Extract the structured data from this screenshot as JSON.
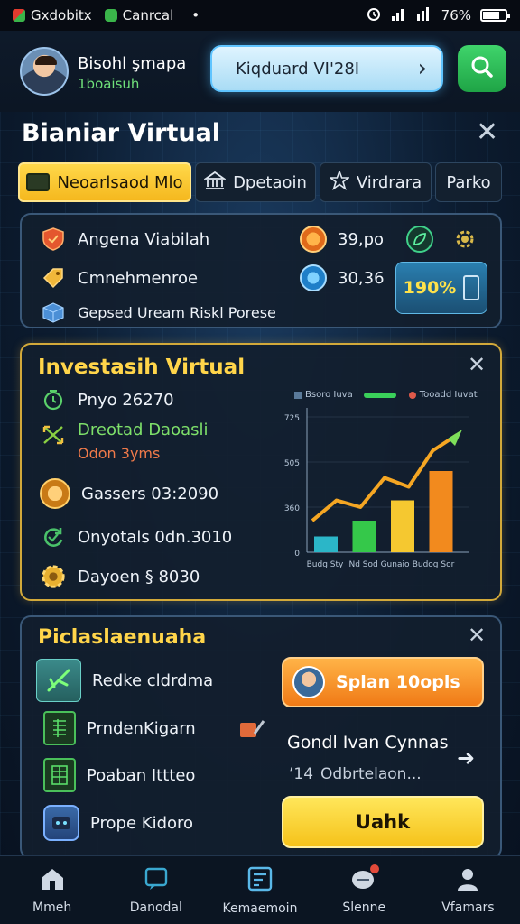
{
  "status_bar": {
    "app1": "Gxdobitx",
    "app2": "Canrcal",
    "dot": "•",
    "battery": "76%",
    "battery_level": 0.76
  },
  "header": {
    "user_name": "Bisohl şmapa",
    "user_sub": "1boaisuh",
    "search_value": "Kiqduard VI'28I",
    "search_chevron": "›"
  },
  "page": {
    "title": "Bianiar Virtual",
    "close": "✕"
  },
  "tabs": [
    {
      "label": "Neoarlsaod Mlo",
      "icon": "wallet-icon",
      "active": true
    },
    {
      "label": "Dpetaoin",
      "icon": "bank-icon",
      "active": false
    },
    {
      "label": "Virdrara",
      "icon": "star-icon",
      "active": false
    },
    {
      "label": "Parko",
      "icon": "",
      "active": false
    }
  ],
  "summary": {
    "rows": [
      {
        "label": "Angena Viabilah",
        "icon": "shield-icon",
        "color": "#e4572e"
      },
      {
        "label": "Cmnehmenroe",
        "icon": "tag-icon",
        "color": "#f0b73a"
      },
      {
        "label": "Gepsed Uream Riskl Porese",
        "icon": "box-icon",
        "color": "#5aa6e8"
      }
    ],
    "values": [
      {
        "value": "39,po",
        "icon": "coin-icon",
        "color": "#f08a2a"
      },
      {
        "value": "30,36",
        "icon": "globe-icon",
        "color": "#3a9fe0"
      }
    ],
    "percent_badge": "190%",
    "percent_small": "%"
  },
  "invest": {
    "title": "Investasih Virtual",
    "close": "✕",
    "items": [
      {
        "label": "Pnyo 26270",
        "icon": "clock-icon",
        "color": "#5ad06a",
        "sub": ""
      },
      {
        "label": "Dreotad Daoasli",
        "icon": "exchange-icon",
        "color": "#8ad042",
        "sub": "Odon 3yms"
      },
      {
        "label": "Gassers 03:2090",
        "icon": "medal-icon",
        "color": "#f0a030",
        "sub": ""
      },
      {
        "label": "Onyotals 0dn.3010",
        "icon": "refresh-icon",
        "color": "#4ac26a",
        "sub": ""
      },
      {
        "label": "Dayoen § 8030",
        "icon": "gear-icon",
        "color": "#e8b030",
        "sub": ""
      }
    ]
  },
  "chart_data": {
    "type": "bar",
    "title": "",
    "legend": [
      "Bsoro Iuva",
      "Tooadd Iuvat"
    ],
    "ytick_labels": [
      "725",
      "505",
      "360",
      "0"
    ],
    "categories": [
      "Budg Sty",
      "Nd Sod Gunaio",
      "Budog Sor"
    ],
    "values": [
      14,
      28,
      46,
      72
    ],
    "trend": [
      28,
      46,
      40,
      66,
      58,
      90,
      104
    ],
    "colors": [
      "#2bb6c8",
      "#35c84a",
      "#f5c830",
      "#f28a1e"
    ],
    "ylim": [
      0,
      120
    ]
  },
  "plans": {
    "title": "Piclaslaenuaha",
    "close": "✕",
    "items": [
      {
        "label": "Redke cldrdma",
        "icon": "plane-icon"
      },
      {
        "label": "PrndenKigarn",
        "icon": "ledger-icon"
      },
      {
        "label": "Poaban Ittteo",
        "icon": "sheet-icon"
      },
      {
        "label": "Prope Kidoro",
        "icon": "robot-icon"
      }
    ],
    "cta_primary": "Splan 10opls",
    "right_heading": "Gondl Ivan Cynnas",
    "right_sub": "Odbrtelaon...",
    "right_prefix": "’14",
    "arrow": "➜",
    "cta_secondary": "Uahk"
  },
  "bottom_nav": [
    {
      "label": "Mmeh",
      "icon": "home-icon"
    },
    {
      "label": "Danodal",
      "icon": "chat-icon"
    },
    {
      "label": "Kemaemoin",
      "icon": "portfolio-icon"
    },
    {
      "label": "Slenne",
      "icon": "notification-icon"
    },
    {
      "label": "Vfamars",
      "icon": "profile-icon"
    }
  ]
}
